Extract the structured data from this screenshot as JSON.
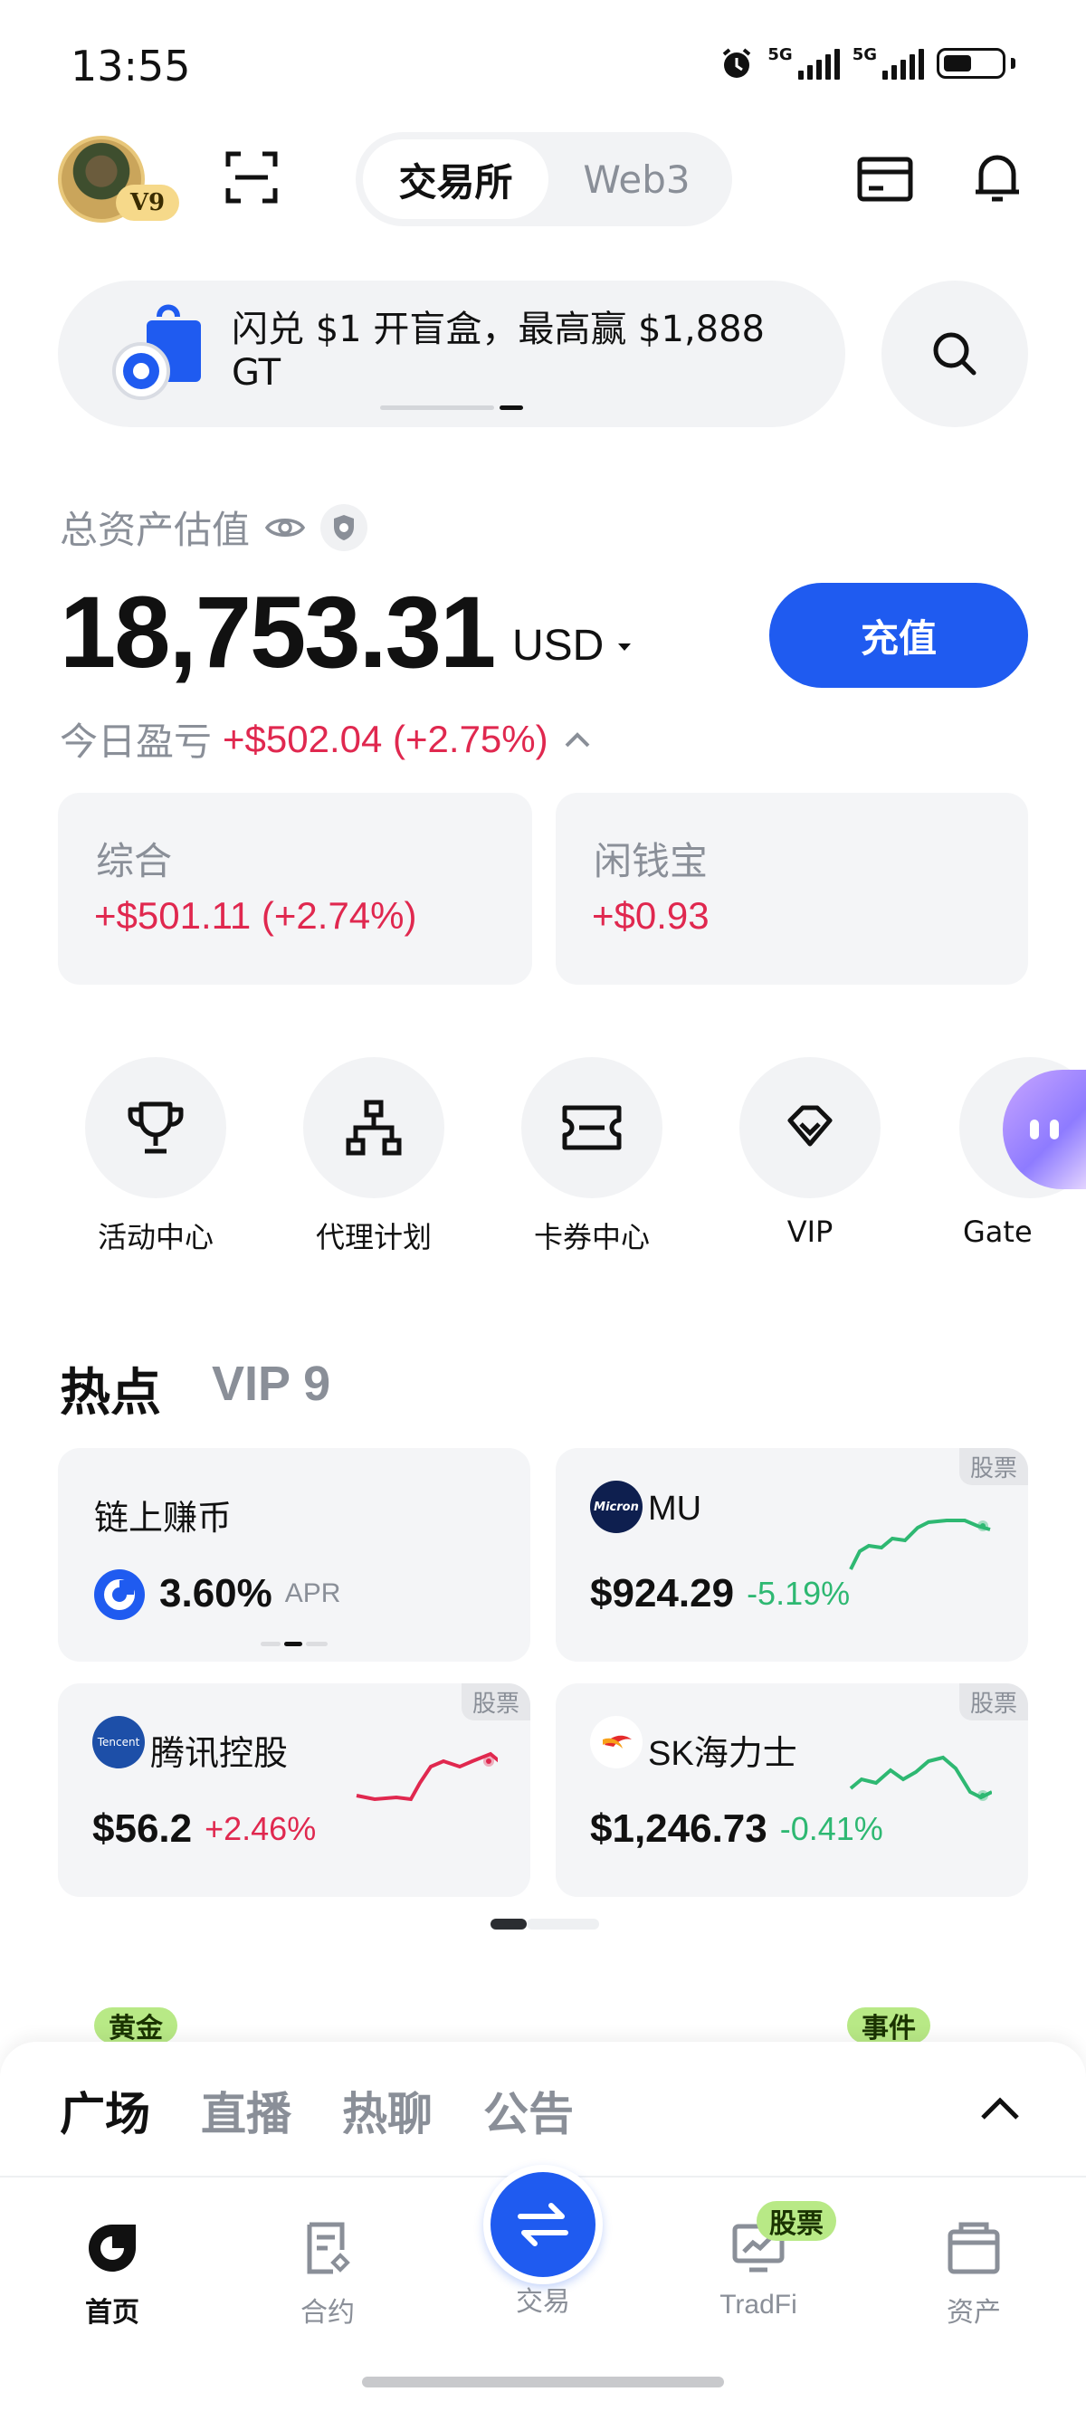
{
  "status_bar": {
    "time": "13:55",
    "net1": "5G",
    "net2": "5G"
  },
  "header": {
    "vip_badge": "V9",
    "tabs": [
      {
        "label": "交易所",
        "active": true
      },
      {
        "label": "Web3",
        "active": false
      }
    ]
  },
  "banner": {
    "text": "闪兑 $1 开盲盒，最高赢 $1,888 GT"
  },
  "assets": {
    "label": "总资产估值",
    "total": "18,753.31",
    "currency": "USD",
    "deposit_label": "充值",
    "pnl_label": "今日盈亏",
    "pnl_value": "+$502.04 (+2.75%)",
    "cards": [
      {
        "title": "综合",
        "value": "+$501.11 (+2.74%)"
      },
      {
        "title": "闲钱宝",
        "value": "+$0.93"
      }
    ]
  },
  "shortcuts": [
    {
      "label": "活动中心",
      "icon": "trophy-icon"
    },
    {
      "label": "代理计划",
      "icon": "org-chart-icon"
    },
    {
      "label": "卡券中心",
      "icon": "ticket-icon"
    },
    {
      "label": "VIP",
      "icon": "diamond-icon"
    },
    {
      "label": "Gate",
      "icon": "bag-icon"
    }
  ],
  "hot": {
    "title": "热点",
    "vip": "VIP 9",
    "cards": [
      {
        "name": "链上赚币",
        "value": "3.60%",
        "unit": "APR"
      },
      {
        "name": "MU",
        "tag": "股票",
        "price": "$924.29",
        "change": "-5.19%",
        "logo_text": "Micron"
      },
      {
        "name": "腾讯控股",
        "tag": "股票",
        "price": "$56.2",
        "change": "+2.46%",
        "logo_text": "Tencent"
      },
      {
        "name": "SK海力士",
        "tag": "股票",
        "price": "$1,246.73",
        "change": "-0.41%"
      }
    ]
  },
  "pills": {
    "gold": "黄金",
    "event": "事件"
  },
  "feed_tabs": [
    "广场",
    "直播",
    "热聊",
    "公告"
  ],
  "bottom_nav": {
    "items": [
      {
        "label": "首页",
        "icon": "home-icon",
        "active": true
      },
      {
        "label": "合约",
        "icon": "contract-icon",
        "active": false
      },
      {
        "label": "交易",
        "icon": "swap-icon",
        "active": false
      },
      {
        "label": "TradFi",
        "icon": "tradfi-icon",
        "active": false
      },
      {
        "label": "资产",
        "icon": "wallet-icon",
        "active": false
      }
    ],
    "tradfi_badge": "股票"
  },
  "colors": {
    "accent": "#1f5bf0",
    "up": "#e0284f",
    "down": "#2eb872",
    "muted": "#8a8f98"
  }
}
